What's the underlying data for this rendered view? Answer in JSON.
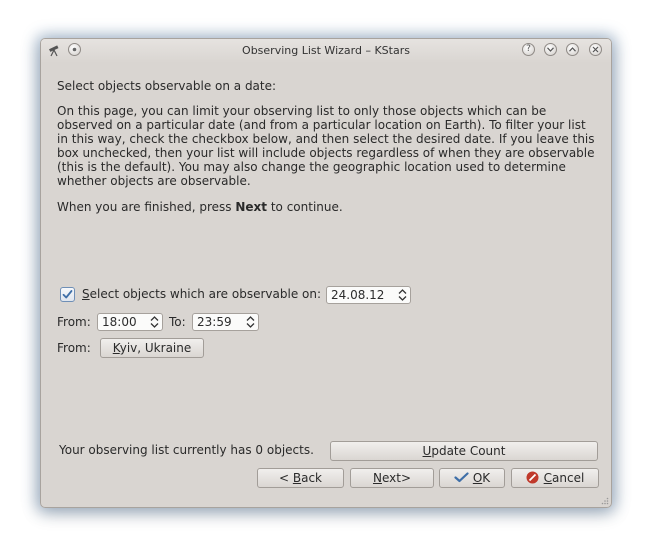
{
  "window": {
    "title": "Observing List Wizard – KStars"
  },
  "page": {
    "heading": "Select objects observable on a date:",
    "description": "On this page, you can limit your observing list to only those objects which can be observed on a particular date (and from a particular location on Earth). To filter your list in this way, check the checkbox below, and then select the desired date. If you leave this box unchecked, then your list will include objects regardless of when they are observable (this is the default). You may also change the geographic location used to determine whether objects are observable.",
    "finish_pre": "When you are finished, press ",
    "finish_bold": "Next",
    "finish_post": " to continue."
  },
  "filter": {
    "checkbox_checked": true,
    "checkbox_mnemonic": "S",
    "checkbox_rest": "elect objects which are observable on:",
    "date_value": "24.08.12",
    "from_label": "From:",
    "from_time": "18:00",
    "to_label": "To:",
    "to_time": "23:59",
    "location_label": "From:",
    "location_mnemonic": "K",
    "location_rest": "yiv, Ukraine"
  },
  "footer": {
    "count_text": "Your observing list currently has 0 objects.",
    "update_mnemonic": "U",
    "update_rest": "pdate Count",
    "back_pre": "< ",
    "back_mnemonic": "B",
    "back_rest": "ack",
    "next_mnemonic": "N",
    "next_rest": "ext>",
    "ok_mnemonic": "O",
    "ok_rest": "K",
    "cancel_mnemonic": "C",
    "cancel_rest": "ancel"
  },
  "colors": {
    "window_bg": "#d9d5d1",
    "check_blue": "#3f6fa8",
    "cancel_red": "#c0392b",
    "ok_blue": "#3f6fa8"
  },
  "icons": {
    "app": "telescope-icon",
    "sticky": "sticky-icon",
    "help": "help-icon",
    "minimize": "minimize-icon",
    "maximize": "maximize-icon",
    "close": "close-icon"
  }
}
